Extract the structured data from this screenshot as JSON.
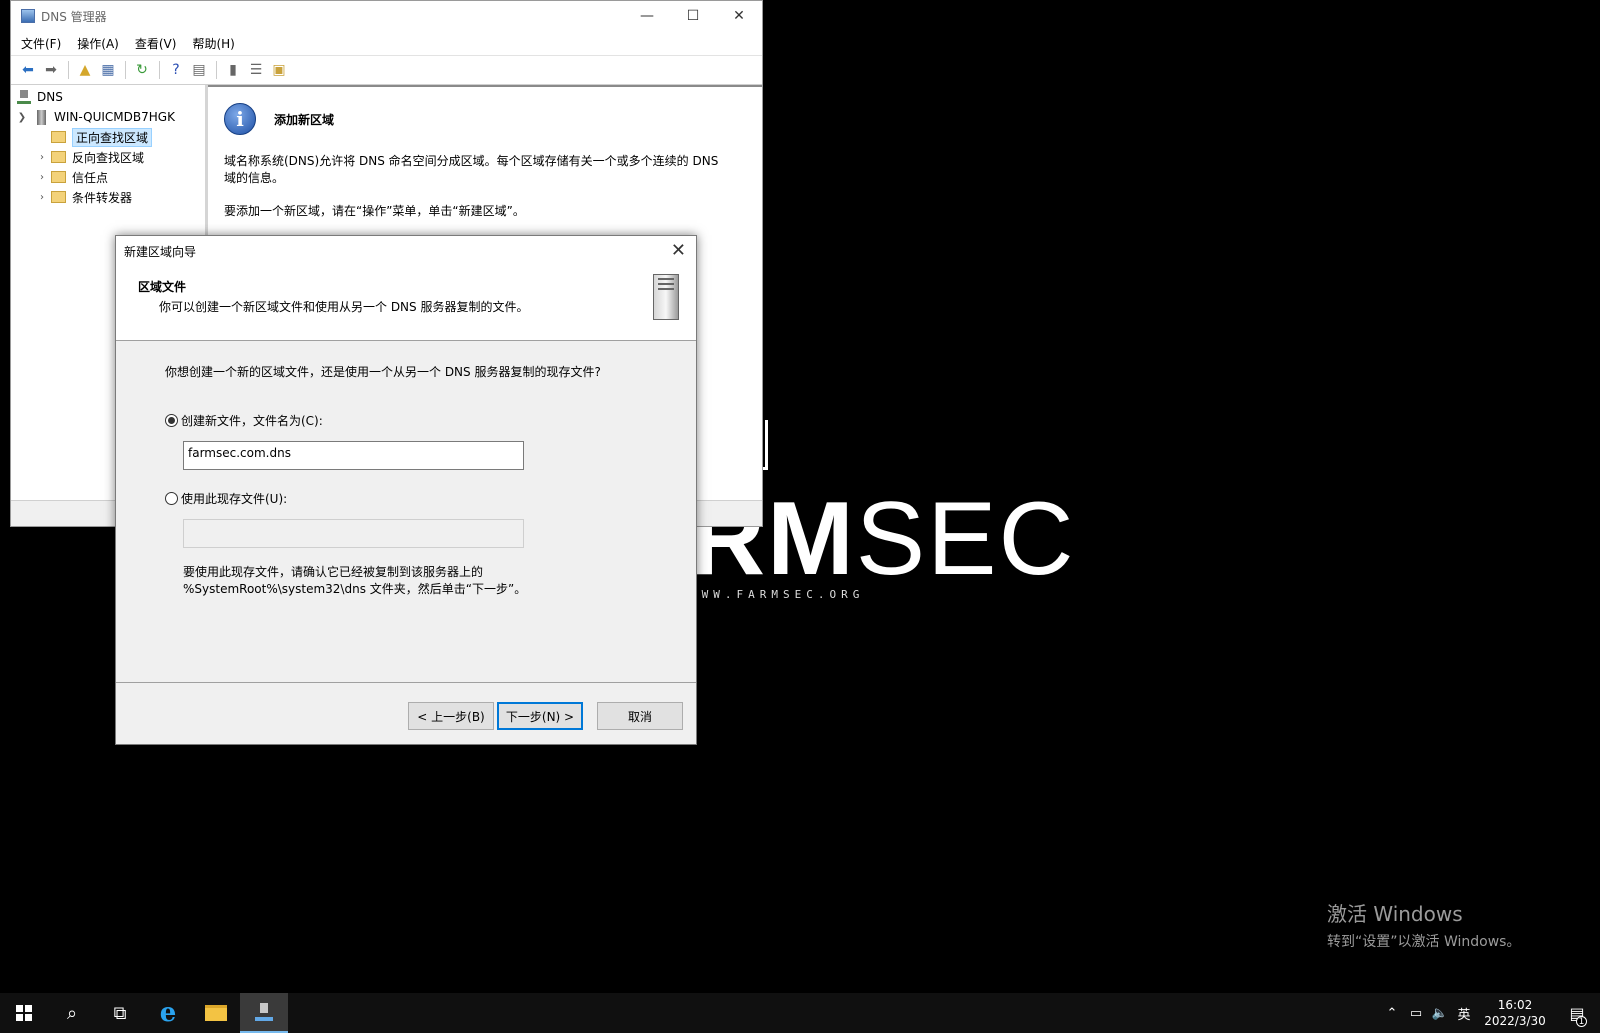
{
  "desktop": {
    "logo_text_bold": "RM",
    "logo_text_light": "SEC",
    "logo_sub": "WWW.FARMSEC.ORG",
    "activate_title": "激活 Windows",
    "activate_desc": "转到“设置”以激活 Windows。"
  },
  "dns_window": {
    "title": "DNS 管理器",
    "menu": [
      "文件(F)",
      "操作(A)",
      "查看(V)",
      "帮助(H)"
    ],
    "tree": {
      "root": "DNS",
      "server": "WIN-QUICMDB7HGK",
      "items": [
        "正向查找区域",
        "反向查找区域",
        "信任点",
        "条件转发器"
      ]
    },
    "info_title": "添加新区域",
    "info_p1": "域名称系统(DNS)允许将 DNS 命名空间分成区域。每个区域存储有关一个或多个连续的 DNS 域的信息。",
    "info_p2": "要添加一个新区域，请在“操作”菜单，单击“新建区域”。"
  },
  "wizard": {
    "title": "新建区域向导",
    "header_title": "区域文件",
    "header_desc": "你可以创建一个新区域文件和使用从另一个 DNS 服务器复制的文件。",
    "question": "你想创建一个新的区域文件，还是使用一个从另一个 DNS 服务器复制的现存文件?",
    "radio_new_label": "创建新文件，文件名为(C):",
    "new_file_value": "farmsec.com.dns",
    "radio_existing_label": "使用此现存文件(U):",
    "existing_file_value": "",
    "note_line1": "要使用此现存文件，请确认它已经被复制到该服务器上的",
    "note_line2": "%SystemRoot%\\system32\\dns 文件夹，然后单击“下一步”。",
    "btn_back": "< 上一步(B)",
    "btn_next": "下一步(N) >",
    "btn_cancel": "取消"
  },
  "taskbar": {
    "ime": "英",
    "time": "16:02",
    "date": "2022/3/30",
    "notif_count": "1"
  }
}
